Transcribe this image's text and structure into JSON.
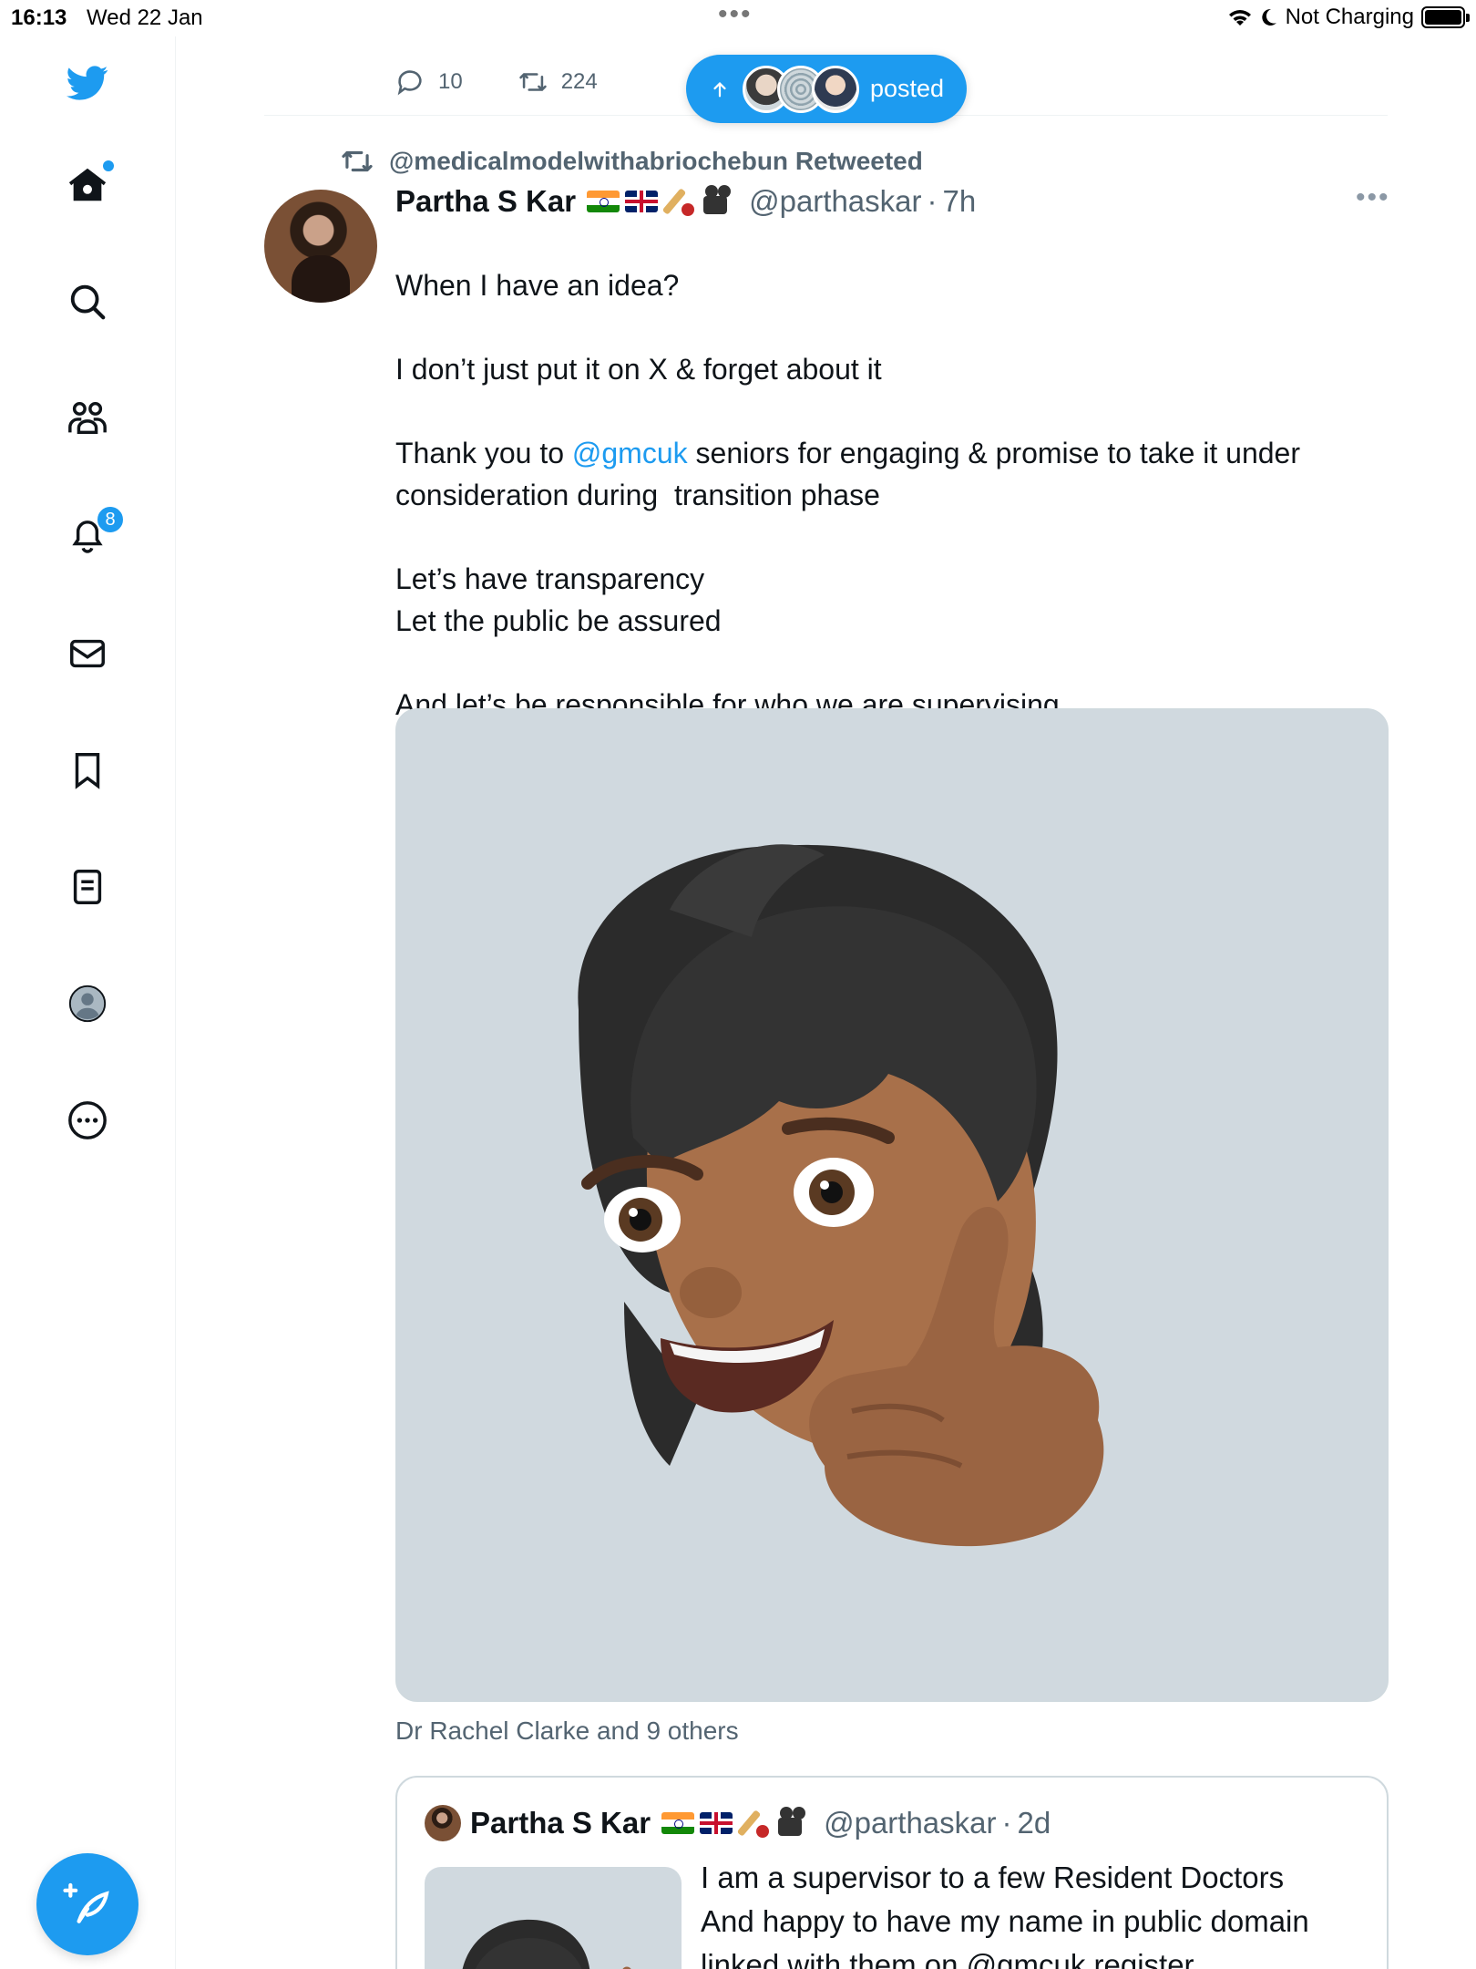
{
  "status_bar": {
    "time": "16:13",
    "date": "Wed 22 Jan",
    "charging": "Not Charging"
  },
  "sidebar": {
    "notifications_badge": "8"
  },
  "engagement": {
    "replies": "10",
    "retweets": "224"
  },
  "pill": {
    "label": "posted"
  },
  "retweet_header": "@medicalmodelwithabriochebun Retweeted",
  "tweet": {
    "name": "Partha S Kar",
    "handle": "@parthaskar",
    "time": "7h",
    "text_1": "When I have an idea?\n\nI don’t just put it on X & forget about it\n\nThank you to ",
    "mention": "@gmcuk",
    "text_2": " seniors for engaging & promise to take it under consideration during  transition phase\n\nLet’s have transparency\nLet the public be assured\n\nAnd let’s be responsible for who we are supervising",
    "liked_by": "Dr Rachel Clarke and 9 others"
  },
  "quote": {
    "name": "Partha S Kar",
    "handle": "@parthaskar",
    "time": "2d",
    "text": "I am a supervisor to a few Resident Doctors\nAnd happy to have my name in public domain\nlinked with them on @gmcuk register"
  },
  "colors": {
    "accent": "#1d9bf0",
    "secondary_text": "#536471",
    "media_bg": "#d0d9df"
  }
}
